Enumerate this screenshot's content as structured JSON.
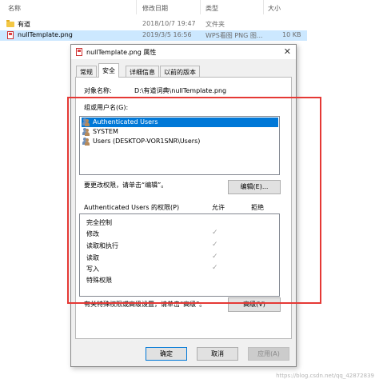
{
  "explorer": {
    "headers": {
      "name": "名称",
      "date": "修改日期",
      "type": "类型",
      "size": "大小"
    },
    "files": [
      {
        "name": "有道",
        "date": "2018/10/7 19:47",
        "type": "文件夹",
        "size": "",
        "icon": "folder-icon",
        "selected": false
      },
      {
        "name": "nullTemplate.png",
        "date": "2019/3/5 16:56",
        "type": "WPS看图 PNG 图...",
        "size": "10 KB",
        "icon": "png-file-icon",
        "selected": true
      }
    ]
  },
  "dialog": {
    "title": "nullTemplate.png 属性",
    "close_glyph": "✕",
    "tabs": [
      {
        "label": "常规",
        "active": false
      },
      {
        "label": "安全",
        "active": true
      },
      {
        "label": "详细信息",
        "active": false
      },
      {
        "label": "以前的版本",
        "active": false
      }
    ],
    "object_label": "对象名称:",
    "object_value": "D:\\有道词典\\nullTemplate.png",
    "groups_label": "组或用户名(G):",
    "users": [
      {
        "name": "Authenticated Users",
        "selected": true
      },
      {
        "name": "SYSTEM",
        "selected": false
      },
      {
        "name": "Users (DESKTOP-VOR1SNR\\Users)",
        "selected": false
      }
    ],
    "change_hint": "要更改权限，请单击“编辑”。",
    "edit_button": "编辑(E)...",
    "perm_header": "Authenticated Users 的权限(P)",
    "allow_header": "允许",
    "deny_header": "拒绝",
    "permissions": [
      {
        "name": "完全控制",
        "allow": false
      },
      {
        "name": "修改",
        "allow": true
      },
      {
        "name": "读取和执行",
        "allow": true
      },
      {
        "name": "读取",
        "allow": true
      },
      {
        "name": "写入",
        "allow": true
      },
      {
        "name": "特殊权限",
        "allow": false
      }
    ],
    "check_glyph": "✓",
    "advanced_hint": "有关特殊权限或高级设置，请单击“高级”。",
    "advanced_button": "高级(V)",
    "ok_button": "确定",
    "cancel_button": "取消",
    "apply_button": "应用(A)"
  },
  "annotation_color": "#e53935",
  "accent_color": "#0078d7",
  "watermark": "https://blog.csdn.net/qq_42872839"
}
